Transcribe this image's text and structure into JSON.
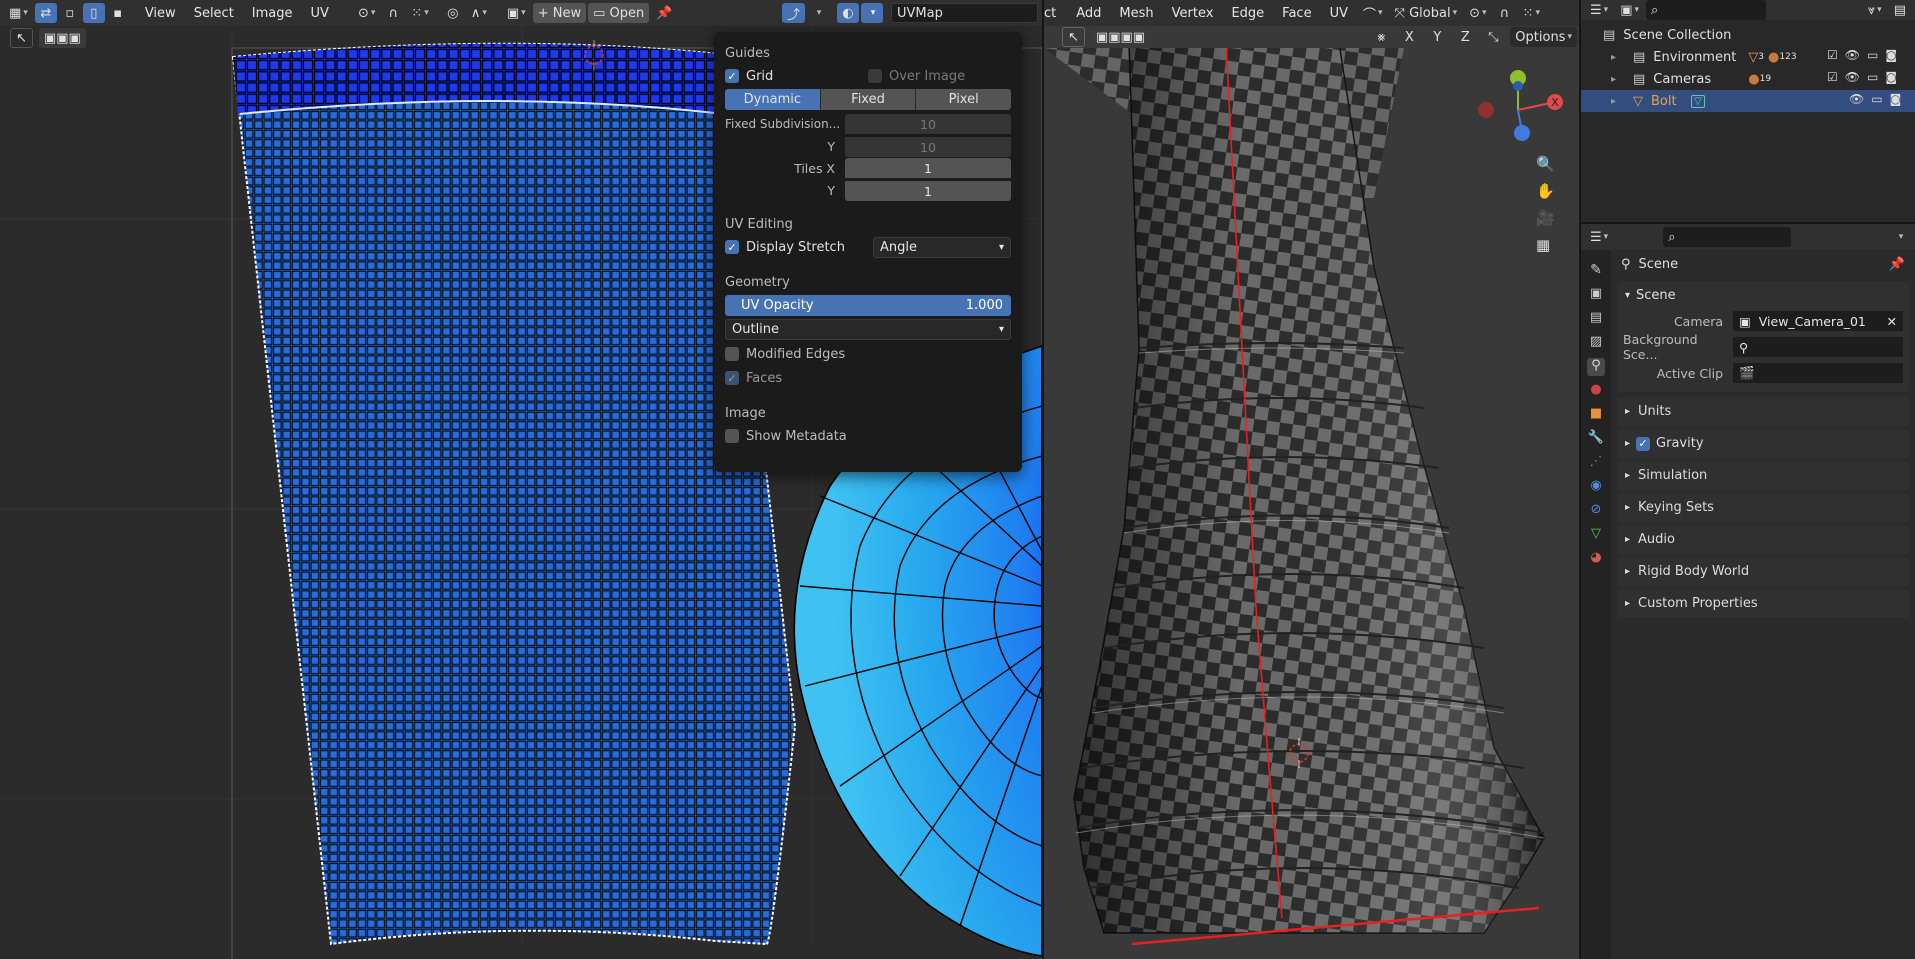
{
  "uv_editor": {
    "menus": [
      "View",
      "Select",
      "Image",
      "UV"
    ],
    "new_label": "New",
    "open_label": "Open",
    "uvmap_name": "UVMap"
  },
  "overlay_popover": {
    "guides_title": "Guides",
    "grid_label": "Grid",
    "over_image_label": "Over Image",
    "grid_modes": [
      "Dynamic",
      "Fixed",
      "Pixel"
    ],
    "active_mode": "Dynamic",
    "fixed_subdivisions_label": "Fixed Subdivision...",
    "fixed_subdivisions_x": "10",
    "fixed_subdivisions_y_label": "Y",
    "fixed_subdivisions_y": "10",
    "tiles_x_label": "Tiles X",
    "tiles_x": "1",
    "tiles_y_label": "Y",
    "tiles_y": "1",
    "uv_editing_title": "UV Editing",
    "display_stretch_label": "Display Stretch",
    "stretch_mode": "Angle",
    "geometry_title": "Geometry",
    "uv_opacity_label": "UV Opacity",
    "uv_opacity_value": "1.000",
    "edge_display": "Outline",
    "modified_edges_label": "Modified Edges",
    "faces_label": "Faces",
    "image_title": "Image",
    "show_metadata_label": "Show Metadata"
  },
  "viewport": {
    "menus_partial": "ct",
    "menus": [
      "Add",
      "Mesh",
      "Vertex",
      "Edge",
      "Face",
      "UV"
    ],
    "orientation": "Global",
    "axes": [
      "X",
      "Y",
      "Z"
    ],
    "options_label": "Options",
    "gizmo_x": "X"
  },
  "outliner": {
    "collection": "Scene Collection",
    "items": [
      {
        "name": "Environment",
        "extra": "3",
        "extra2": "123"
      },
      {
        "name": "Cameras",
        "extra": "19"
      },
      {
        "name": "Bolt",
        "extra": ""
      }
    ]
  },
  "properties": {
    "header": "Scene",
    "panel": "Scene",
    "camera_label": "Camera",
    "camera_value": "View_Camera_01",
    "background_label": "Background Sce...",
    "active_clip_label": "Active Clip",
    "sections": [
      "Units",
      "Gravity",
      "Simulation",
      "Keying Sets",
      "Audio",
      "Rigid Body World",
      "Custom Properties"
    ]
  },
  "colors": {
    "accent": "#4772b3",
    "header": "#303030",
    "bolt_selected": "#e8a23c"
  }
}
